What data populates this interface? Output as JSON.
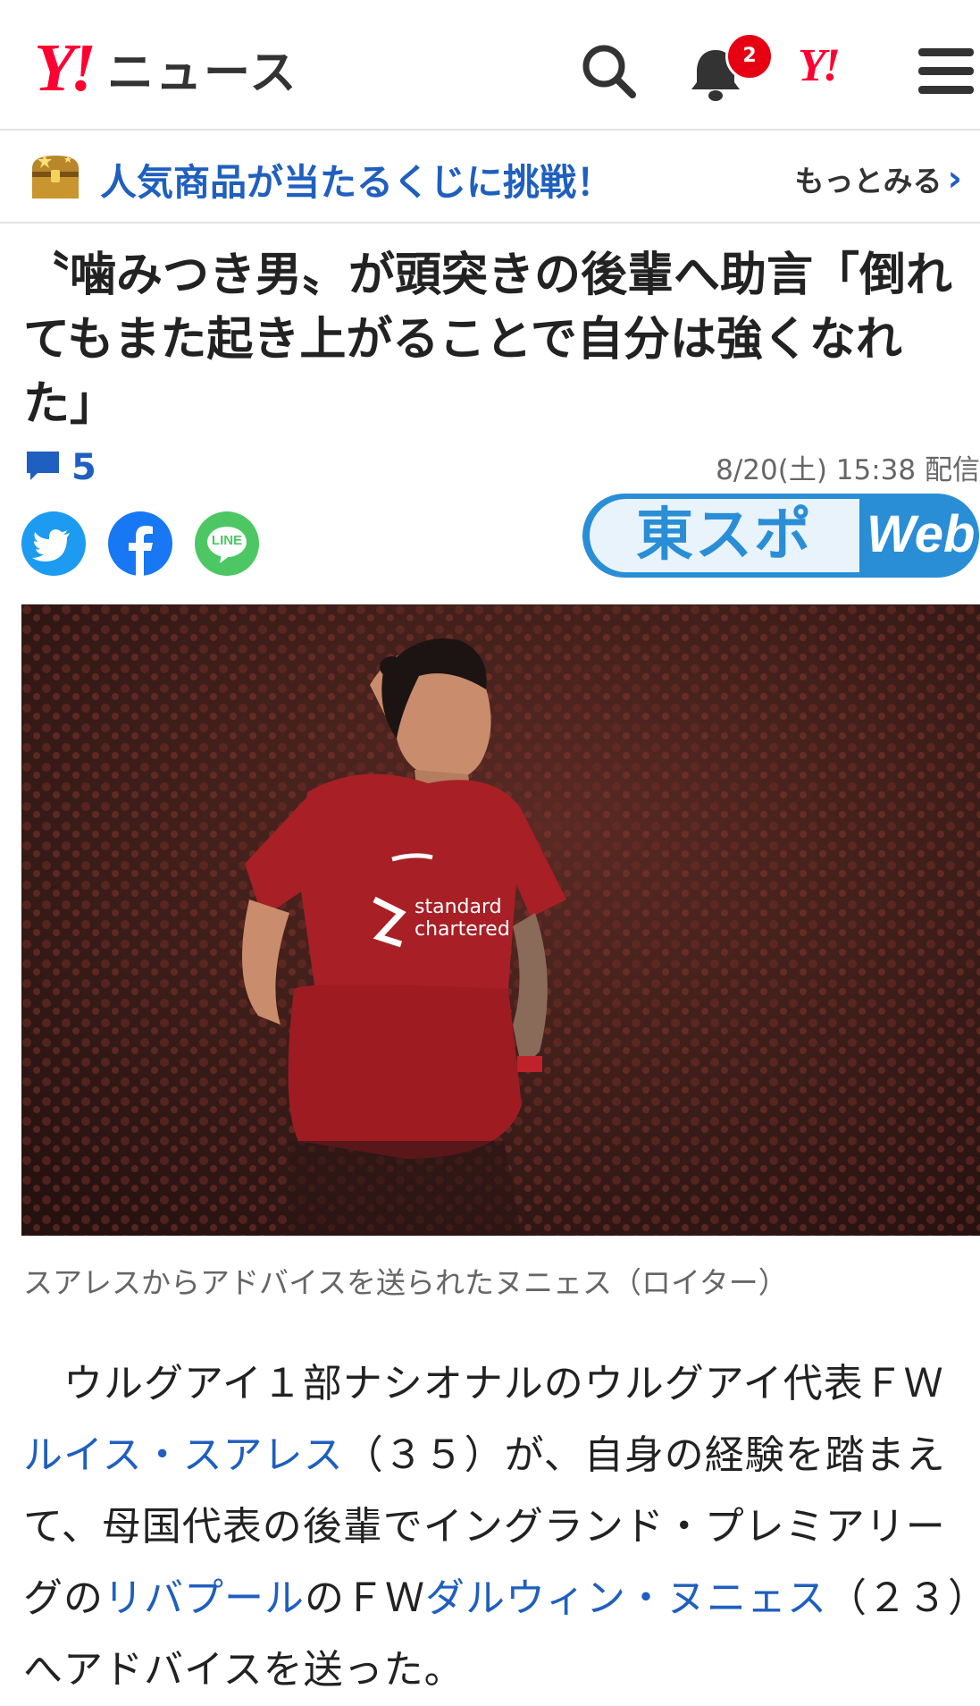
{
  "header": {
    "logo_mark": "Y!",
    "brand": "ニュース",
    "notification_count": "2",
    "yahoo_mark": "Y!"
  },
  "promo": {
    "text": "人気商品が当たるくじに挑戦！",
    "more": "もっとみる"
  },
  "article": {
    "title": "〝噛みつき男〟が頭突きの後輩へ助言「倒れてもまた起き上がることで自分は強くなれた」",
    "comment_count": "5",
    "published": "8/20(土) 15:38 配信",
    "publisher_ja": "東スポ",
    "publisher_web": "Web",
    "share": {
      "line_label": "LINE"
    },
    "photo_caption": "スアレスからアドバイスを送られたヌニェス（ロイター）",
    "body": {
      "p1_a": "　ウルグアイ１部ナシオナルのウルグアイ代表ＦＷ",
      "link_suarez": "ルイス・スアレス",
      "p1_b": "（３５）が、自身の経験を踏まえて、母国代表の後輩でイングランド・プレミアリーグの",
      "link_liverpool": "リバプール",
      "p1_c": "のＦＷ",
      "link_nunez": "ダルウィン・ヌニェス",
      "p1_d": "（２３）へアドバイスを送った。"
    }
  },
  "colors": {
    "accent_blue": "#1f5fbf",
    "yahoo_red": "#ff0033",
    "twitter": "#1d9bf0",
    "facebook": "#1877f2",
    "line": "#4cc764",
    "kit_red": "#a81f26"
  }
}
